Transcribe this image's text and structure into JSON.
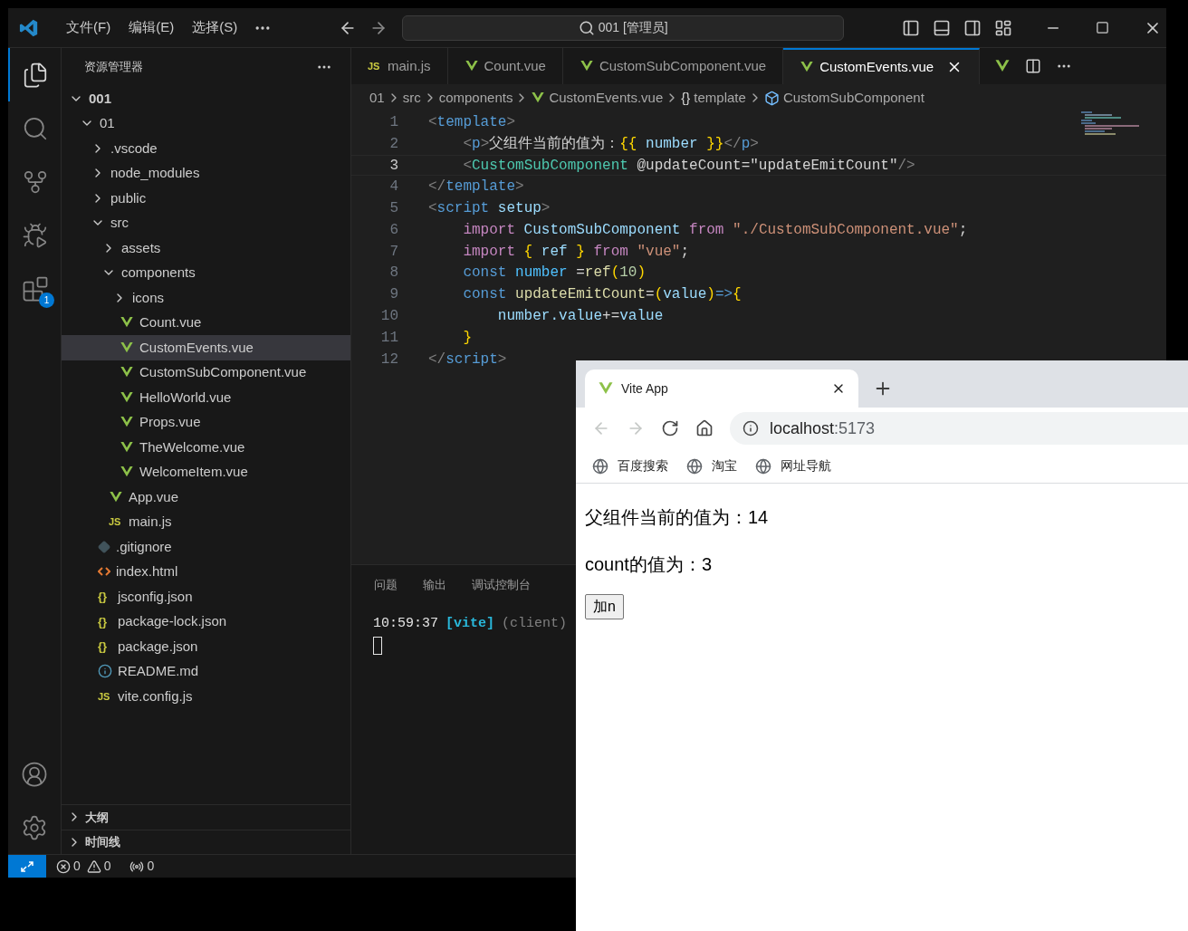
{
  "title_bar": {
    "menus": [
      "文件(F)",
      "编辑(E)",
      "选择(S)"
    ],
    "command_center": "001 [管理员]"
  },
  "activity_bar": {
    "items": [
      {
        "kind": "explorer",
        "selected": true
      },
      {
        "kind": "search",
        "selected": false
      },
      {
        "kind": "source-control",
        "selected": false
      },
      {
        "kind": "run-debug",
        "selected": false
      },
      {
        "kind": "extensions",
        "selected": false,
        "badge": "1"
      }
    ],
    "bottom": [
      {
        "kind": "account"
      },
      {
        "kind": "settings"
      }
    ]
  },
  "explorer": {
    "title": "资源管理器",
    "tree": [
      {
        "label": "001",
        "kind": "root",
        "expanded": true,
        "selected": false,
        "children": [
          {
            "label": "01",
            "kind": "folder",
            "expanded": true,
            "selected": false,
            "children": [
              {
                "label": ".vscode",
                "kind": "folder",
                "expanded": false,
                "selected": false
              },
              {
                "label": "node_modules",
                "kind": "folder",
                "expanded": false,
                "selected": false
              },
              {
                "label": "public",
                "kind": "folder",
                "expanded": false,
                "selected": false
              },
              {
                "label": "src",
                "kind": "folder",
                "expanded": true,
                "selected": false,
                "children": [
                  {
                    "label": "assets",
                    "kind": "folder",
                    "expanded": false,
                    "selected": false
                  },
                  {
                    "label": "components",
                    "kind": "folder",
                    "expanded": true,
                    "selected": false,
                    "children": [
                      {
                        "label": "icons",
                        "kind": "folder",
                        "expanded": false,
                        "selected": false
                      },
                      {
                        "label": "Count.vue",
                        "kind": "vue",
                        "selected": false
                      },
                      {
                        "label": "CustomEvents.vue",
                        "kind": "vue",
                        "selected": true
                      },
                      {
                        "label": "CustomSubComponent.vue",
                        "kind": "vue",
                        "selected": false
                      },
                      {
                        "label": "HelloWorld.vue",
                        "kind": "vue",
                        "selected": false
                      },
                      {
                        "label": "Props.vue",
                        "kind": "vue",
                        "selected": false
                      },
                      {
                        "label": "TheWelcome.vue",
                        "kind": "vue",
                        "selected": false
                      },
                      {
                        "label": "WelcomeItem.vue",
                        "kind": "vue",
                        "selected": false
                      }
                    ]
                  },
                  {
                    "label": "App.vue",
                    "kind": "vue",
                    "selected": false
                  },
                  {
                    "label": "main.js",
                    "kind": "js",
                    "icon_text": "JS",
                    "selected": false
                  }
                ]
              },
              {
                "label": ".gitignore",
                "kind": "git",
                "selected": false
              },
              {
                "label": "index.html",
                "kind": "html",
                "selected": false
              },
              {
                "label": "jsconfig.json",
                "kind": "json",
                "icon_text": "{}",
                "selected": false
              },
              {
                "label": "package-lock.json",
                "kind": "json",
                "icon_text": "{}",
                "selected": false
              },
              {
                "label": "package.json",
                "kind": "json",
                "icon_text": "{}",
                "selected": false
              },
              {
                "label": "README.md",
                "kind": "info",
                "selected": false
              },
              {
                "label": "vite.config.js",
                "kind": "js",
                "icon_text": "JS",
                "selected": false
              }
            ]
          }
        ]
      }
    ],
    "sections": [
      {
        "label": "大纲",
        "expanded": false
      },
      {
        "label": "时间线",
        "expanded": false
      }
    ]
  },
  "editor": {
    "tabs": [
      {
        "label": "main.js",
        "kind": "js",
        "icon_text": "JS",
        "selected": false
      },
      {
        "label": "Count.vue",
        "kind": "vue",
        "selected": false
      },
      {
        "label": "CustomSubComponent.vue",
        "kind": "vue",
        "selected": false
      },
      {
        "label": "CustomEvents.vue",
        "kind": "vue",
        "selected": true
      }
    ],
    "breadcrumb": [
      {
        "label": "01",
        "kind": "folder"
      },
      {
        "label": "src",
        "kind": "folder"
      },
      {
        "label": "components",
        "kind": "folder"
      },
      {
        "label": "CustomEvents.vue",
        "kind": "vue"
      },
      {
        "label": "template",
        "kind": "braces",
        "icon_text": "{}"
      },
      {
        "label": "CustomSubComponent",
        "kind": "component"
      }
    ],
    "lines": [
      {
        "number": "1",
        "current": false,
        "tokens": [
          {
            "t": "<",
            "kind": "punct"
          },
          {
            "t": "template",
            "kind": "tag"
          },
          {
            "t": ">",
            "kind": "punct"
          }
        ]
      },
      {
        "number": "2",
        "current": false,
        "tokens": [
          {
            "t": "    <",
            "kind": "punct"
          },
          {
            "t": "p",
            "kind": "tag"
          },
          {
            "t": ">",
            "kind": "punct"
          },
          {
            "t": "父组件当前的值为：",
            "kind": "text"
          },
          {
            "t": "{{",
            "kind": "bracket"
          },
          {
            "t": " number ",
            "kind": "var"
          },
          {
            "t": "}}",
            "kind": "bracket"
          },
          {
            "t": "</",
            "kind": "punct"
          },
          {
            "t": "p",
            "kind": "tag"
          },
          {
            "t": ">",
            "kind": "punct"
          }
        ]
      },
      {
        "number": "3",
        "current": true,
        "tokens": [
          {
            "t": "    <",
            "kind": "punct"
          },
          {
            "t": "CustomSubComponent",
            "kind": "component"
          },
          {
            "t": " @updateCount=\"updateEmitCount\"",
            "kind": "text"
          },
          {
            "t": "/>",
            "kind": "punct"
          }
        ]
      },
      {
        "number": "4",
        "current": false,
        "tokens": [
          {
            "t": "</",
            "kind": "punct"
          },
          {
            "t": "template",
            "kind": "tag"
          },
          {
            "t": ">",
            "kind": "punct"
          }
        ]
      },
      {
        "number": "5",
        "current": false,
        "tokens": [
          {
            "t": "<",
            "kind": "punct"
          },
          {
            "t": "script",
            "kind": "tag"
          },
          {
            "t": " setup",
            "kind": "var"
          },
          {
            "t": ">",
            "kind": "punct"
          }
        ]
      },
      {
        "number": "6",
        "current": false,
        "tokens": [
          {
            "t": "    import",
            "kind": "control"
          },
          {
            "t": " CustomSubComponent",
            "kind": "var"
          },
          {
            "t": " from",
            "kind": "control"
          },
          {
            "t": " \"./CustomSubComponent.vue\"",
            "kind": "string"
          },
          {
            "t": ";",
            "kind": "text"
          }
        ]
      },
      {
        "number": "7",
        "current": false,
        "tokens": [
          {
            "t": "    import",
            "kind": "control"
          },
          {
            "t": " {",
            "kind": "bracket"
          },
          {
            "t": " ref ",
            "kind": "var"
          },
          {
            "t": "}",
            "kind": "bracket"
          },
          {
            "t": " from",
            "kind": "control"
          },
          {
            "t": " \"vue\"",
            "kind": "string"
          },
          {
            "t": ";",
            "kind": "text"
          }
        ]
      },
      {
        "number": "8",
        "current": false,
        "tokens": [
          {
            "t": "    const",
            "kind": "keyword"
          },
          {
            "t": " number",
            "kind": "const"
          },
          {
            "t": " =",
            "kind": "text"
          },
          {
            "t": "ref",
            "kind": "func"
          },
          {
            "t": "(",
            "kind": "bracket"
          },
          {
            "t": "10",
            "kind": "number"
          },
          {
            "t": ")",
            "kind": "bracket"
          }
        ]
      },
      {
        "number": "9",
        "current": false,
        "tokens": [
          {
            "t": "    const",
            "kind": "keyword"
          },
          {
            "t": " updateEmitCount",
            "kind": "func"
          },
          {
            "t": "=",
            "kind": "text"
          },
          {
            "t": "(",
            "kind": "bracket"
          },
          {
            "t": "value",
            "kind": "var"
          },
          {
            "t": ")",
            "kind": "bracket"
          },
          {
            "t": "=>",
            "kind": "keyword"
          },
          {
            "t": "{",
            "kind": "bracket"
          }
        ]
      },
      {
        "number": "10",
        "current": false,
        "tokens": [
          {
            "t": "        number.value",
            "kind": "var"
          },
          {
            "t": "+=",
            "kind": "text"
          },
          {
            "t": "value",
            "kind": "var"
          }
        ]
      },
      {
        "number": "11",
        "current": false,
        "tokens": [
          {
            "t": "    }",
            "kind": "bracket"
          }
        ]
      },
      {
        "number": "12",
        "current": false,
        "tokens": [
          {
            "t": "</",
            "kind": "punct"
          },
          {
            "t": "script",
            "kind": "tag"
          },
          {
            "t": ">",
            "kind": "punct"
          }
        ]
      }
    ]
  },
  "panel": {
    "tabs": [
      {
        "label": "问题",
        "selected": false
      },
      {
        "label": "输出",
        "selected": false
      },
      {
        "label": "调试控制台",
        "selected": false
      }
    ],
    "terminal": {
      "time": "10:59:37",
      "source": "[vite]",
      "context": "(client)"
    }
  },
  "status_bar": {
    "errors": "0",
    "warnings": "0",
    "ports": "0"
  },
  "browser": {
    "tabs": [
      {
        "title": "Vite App",
        "selected": true
      }
    ],
    "nav": [
      {
        "kind": "back",
        "disabled": true
      },
      {
        "kind": "forward",
        "disabled": true
      },
      {
        "kind": "reload",
        "disabled": false
      },
      {
        "kind": "home",
        "disabled": false
      }
    ],
    "address": {
      "host": "localhost",
      "port": ":5173"
    },
    "bookmarks": [
      "百度搜索",
      "淘宝",
      "网址导航"
    ],
    "page": {
      "paragraphs": [
        "父组件当前的值为：14",
        "count的值为：3"
      ],
      "button": "加n"
    }
  }
}
